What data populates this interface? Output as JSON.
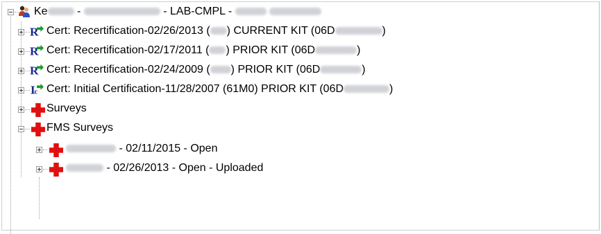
{
  "tree": {
    "root": {
      "label_prefix": "Ke",
      "label_mid": " - ",
      "label_lab": " - LAB-CMPL - ",
      "icon": "people-icon"
    },
    "certs": [
      {
        "text_a": "Cert: Recertification-02/26/2013 (",
        "text_b": ") CURRENT KIT  (06D",
        "text_c": ")",
        "icon": "recert-certificate-icon"
      },
      {
        "text_a": "Cert: Recertification-02/17/2011 (",
        "text_b": ") PRIOR KIT  (06D",
        "text_c": ")",
        "icon": "recert-certificate-icon"
      },
      {
        "text_a": "Cert: Recertification-02/24/2009 (",
        "text_b": ") PRIOR KIT  (06D",
        "text_c": ")",
        "icon": "recert-certificate-icon"
      },
      {
        "text_a": "Cert: Initial Certification-11/28/2007 (61M0) PRIOR KIT  (06D",
        "text_b": "",
        "text_c": ")",
        "icon": "initial-certificate-icon"
      }
    ],
    "surveys_label": "Surveys",
    "fms_surveys_label": "FMS Surveys",
    "fms_children": [
      {
        "text": " - 02/11/2015 - Open"
      },
      {
        "text": " - 02/26/2013 - Open - Uploaded"
      }
    ],
    "colors": {
      "red_cross": "#e01010",
      "cert_blue": "#1a2a8a",
      "arrow_green": "#1a9a2a"
    }
  }
}
